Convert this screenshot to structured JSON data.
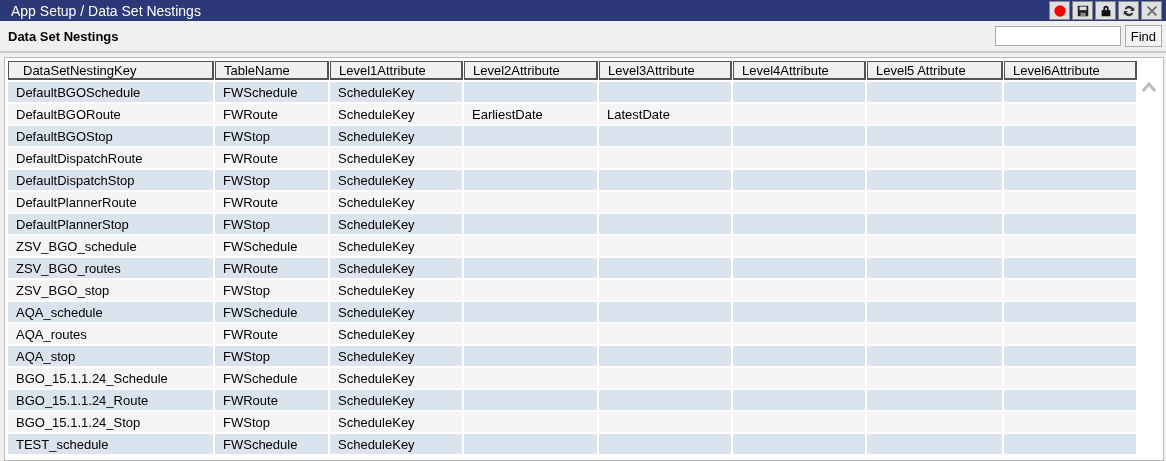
{
  "window": {
    "title": "App Setup / Data Set Nestings",
    "buttons": [
      {
        "kind": "record"
      },
      {
        "kind": "save"
      },
      {
        "kind": "lock"
      },
      {
        "kind": "refresh"
      },
      {
        "kind": "close"
      }
    ]
  },
  "header": {
    "title": "Data Set Nestings",
    "find_button": "Find"
  },
  "table": {
    "columns": [
      "DataSetNestingKey",
      "TableName",
      "Level1Attribute",
      "Level2Attribute",
      "Level3Attribute",
      "Level4Attribute",
      "Level5 Attribute",
      "Level6Attribute"
    ],
    "rows": [
      [
        "DefaultBGOSchedule",
        "FWSchedule",
        "ScheduleKey",
        "",
        "",
        "",
        "",
        ""
      ],
      [
        "DefaultBGORoute",
        "FWRoute",
        "ScheduleKey",
        "EarliestDate",
        "LatestDate",
        "",
        "",
        ""
      ],
      [
        "DefaultBGOStop",
        "FWStop",
        "ScheduleKey",
        "",
        "",
        "",
        "",
        ""
      ],
      [
        "DefaultDispatchRoute",
        "FWRoute",
        "ScheduleKey",
        "",
        "",
        "",
        "",
        ""
      ],
      [
        "DefaultDispatchStop",
        "FWStop",
        "ScheduleKey",
        "",
        "",
        "",
        "",
        ""
      ],
      [
        "DefaultPlannerRoute",
        "FWRoute",
        "ScheduleKey",
        "",
        "",
        "",
        "",
        ""
      ],
      [
        "DefaultPlannerStop",
        "FWStop",
        "ScheduleKey",
        "",
        "",
        "",
        "",
        ""
      ],
      [
        "ZSV_BGO_schedule",
        "FWSchedule",
        "ScheduleKey",
        "",
        "",
        "",
        "",
        ""
      ],
      [
        "ZSV_BGO_routes",
        "FWRoute",
        "ScheduleKey",
        "",
        "",
        "",
        "",
        ""
      ],
      [
        "ZSV_BGO_stop",
        "FWStop",
        "ScheduleKey",
        "",
        "",
        "",
        "",
        ""
      ],
      [
        "AQA_schedule",
        "FWSchedule",
        "ScheduleKey",
        "",
        "",
        "",
        "",
        ""
      ],
      [
        "AQA_routes",
        "FWRoute",
        "ScheduleKey",
        "",
        "",
        "",
        "",
        ""
      ],
      [
        "AQA_stop",
        "FWStop",
        "ScheduleKey",
        "",
        "",
        "",
        "",
        ""
      ],
      [
        "BGO_15.1.1.24_Schedule",
        "FWSchedule",
        "ScheduleKey",
        "",
        "",
        "",
        "",
        ""
      ],
      [
        "BGO_15.1.1.24_Route",
        "FWRoute",
        "ScheduleKey",
        "",
        "",
        "",
        "",
        ""
      ],
      [
        "BGO_15.1.1.24_Stop",
        "FWStop",
        "ScheduleKey",
        "",
        "",
        "",
        "",
        ""
      ],
      [
        "TEST_schedule",
        "FWSchedule",
        "ScheduleKey",
        "",
        "",
        "",
        "",
        ""
      ]
    ]
  }
}
